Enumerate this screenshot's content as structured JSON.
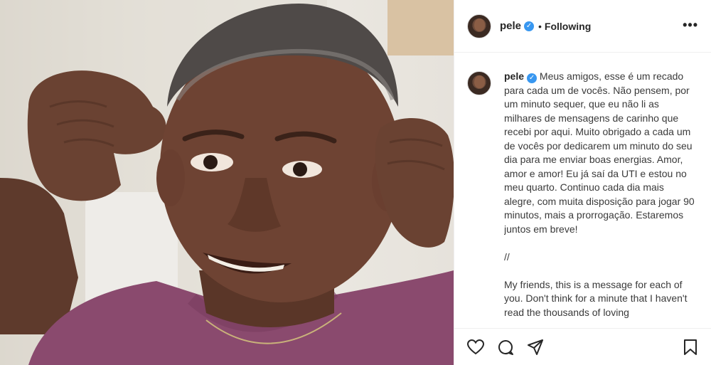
{
  "post": {
    "username": "pele",
    "verified": true,
    "separator": "•",
    "follow_status": "Following",
    "more_label": "•••"
  },
  "caption": {
    "username": "pele",
    "text": "Meus amigos, esse é um recado para cada um de vocês. Não pensem, por um minuto sequer, que eu não li as milhares de mensagens de carinho que recebi por aqui. Muito obrigado a cada um de vocês por dedicarem um minuto do seu dia para me enviar boas energias. Amor, amor e amor! Eu já saí da UTI e estou no meu quarto. Continuo cada dia mais alegre, com muita disposição para jogar 90 minutos, mais a prorrogação. Estaremos juntos em breve!\n\n//\n\nMy friends, this is a message for each of you. Don't think for a minute that I haven't read the thousands of loving"
  },
  "actions": {
    "icons": [
      "heart-icon",
      "comment-icon",
      "share-icon",
      "bookmark-icon"
    ]
  },
  "colors": {
    "verified": "#3897f0",
    "shirt": "#8a4a6e",
    "skin": "#6e4333",
    "border": "#efefef"
  }
}
